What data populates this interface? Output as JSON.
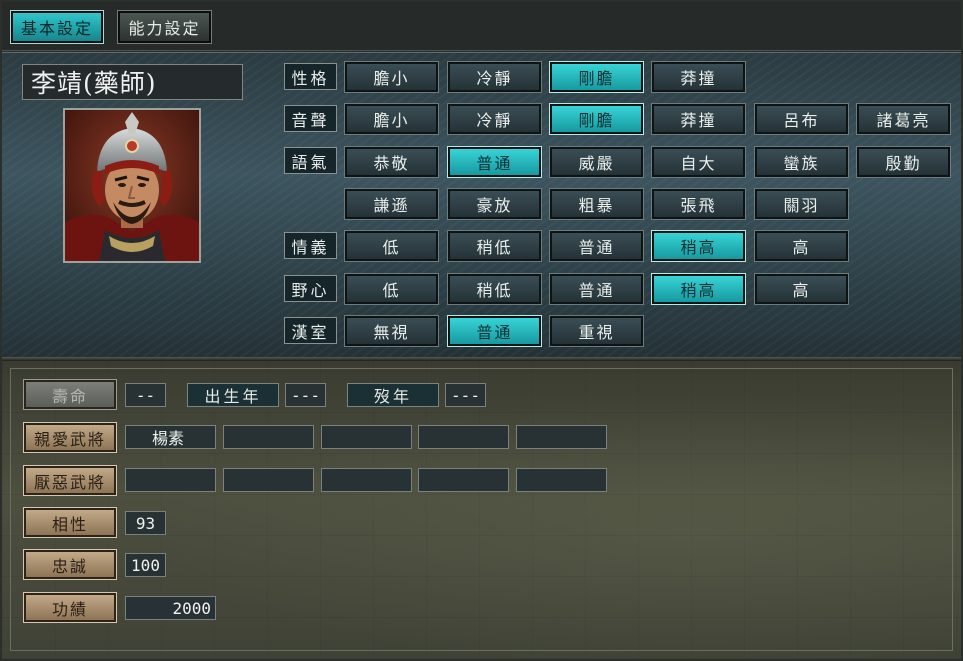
{
  "tabs": [
    {
      "label": "基本設定",
      "active": true
    },
    {
      "label": "能力設定",
      "active": false
    }
  ],
  "officer": {
    "name": "李靖(藥師)"
  },
  "settings": [
    {
      "label": "性格",
      "options": [
        "膽小",
        "冷靜",
        "剛膽",
        "莽撞"
      ],
      "selected": 2
    },
    {
      "label": "音聲",
      "options": [
        "膽小",
        "冷靜",
        "剛膽",
        "莽撞",
        "呂布",
        "諸葛亮"
      ],
      "selected": 2
    },
    {
      "label": "語氣",
      "options": [
        "恭敬",
        "普通",
        "威嚴",
        "自大",
        "蠻族",
        "殷勤"
      ],
      "selected": 1
    },
    {
      "label": "",
      "options": [
        "謙遜",
        "豪放",
        "粗暴",
        "張飛",
        "關羽"
      ],
      "selected": -1
    },
    {
      "label": "情義",
      "options": [
        "低",
        "稍低",
        "普通",
        "稍高",
        "高"
      ],
      "selected": 3
    },
    {
      "label": "野心",
      "options": [
        "低",
        "稍低",
        "普通",
        "稍高",
        "高"
      ],
      "selected": 3
    },
    {
      "label": "漢室",
      "options": [
        "無視",
        "普通",
        "重視"
      ],
      "selected": 1
    }
  ],
  "lifespan": {
    "label": "壽命",
    "value": "--",
    "birth_label": "出生年",
    "birth_value": "---",
    "death_label": "歿年",
    "death_value": "---"
  },
  "liked": {
    "label": "親愛武將",
    "values": [
      "楊素",
      "",
      "",
      "",
      ""
    ]
  },
  "disliked": {
    "label": "厭惡武將",
    "values": [
      "",
      "",
      "",
      "",
      ""
    ]
  },
  "compatibility": {
    "label": "相性",
    "value": "93"
  },
  "loyalty": {
    "label": "忠誠",
    "value": "100"
  },
  "merit": {
    "label": "功績",
    "value": "2000"
  }
}
